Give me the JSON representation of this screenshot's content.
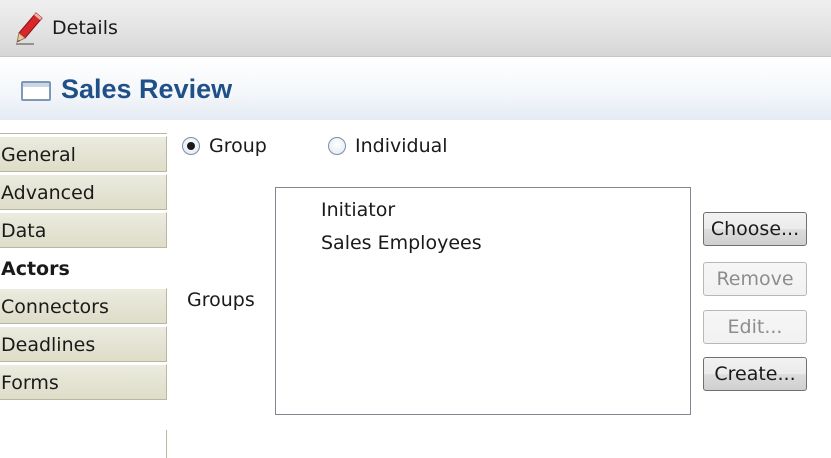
{
  "titlebar": {
    "title": "Details",
    "icon": "pencil-icon"
  },
  "header": {
    "title": "Sales Review",
    "icon": "form-icon"
  },
  "tabs": [
    {
      "label": "General",
      "active": false
    },
    {
      "label": "Advanced",
      "active": false
    },
    {
      "label": "Data",
      "active": false
    },
    {
      "label": "Actors",
      "active": true
    },
    {
      "label": "Connectors",
      "active": false
    },
    {
      "label": "Deadlines",
      "active": false
    },
    {
      "label": "Forms",
      "active": false
    }
  ],
  "actor_type": {
    "options": [
      {
        "label": "Group",
        "checked": true
      },
      {
        "label": "Individual",
        "checked": false
      }
    ]
  },
  "groups": {
    "label": "Groups",
    "items": [
      "Initiator",
      "Sales Employees"
    ]
  },
  "buttons": {
    "choose": {
      "label": "Choose...",
      "enabled": true
    },
    "remove": {
      "label": "Remove",
      "enabled": false
    },
    "edit": {
      "label": "Edit...",
      "enabled": false
    },
    "create": {
      "label": "Create...",
      "enabled": true
    }
  },
  "colors": {
    "header_title": "#1f5088",
    "tab_bg": "#deddc9",
    "pencil_red": "#d8262b"
  }
}
